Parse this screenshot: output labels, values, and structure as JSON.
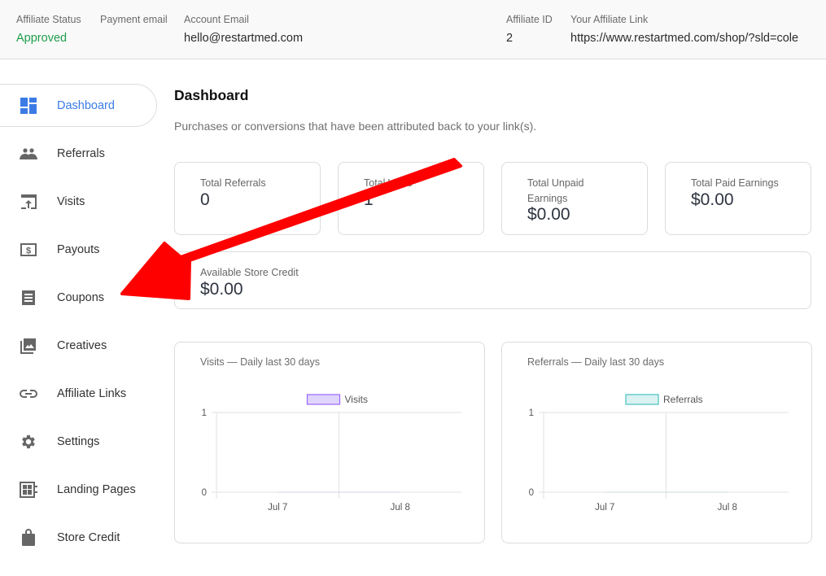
{
  "header": {
    "fields": [
      {
        "label": "Affiliate Status",
        "value": "Approved",
        "status_color": "#1f9d4b"
      },
      {
        "label": "Payment email",
        "value": ""
      },
      {
        "label": "Account Email",
        "value": "hello@restartmed.com"
      },
      {
        "label": "Affiliate ID",
        "value": "2"
      },
      {
        "label": "Your Affiliate Link",
        "value": "https://www.restartmed.com/shop/?sld=cole"
      }
    ]
  },
  "sidebar": {
    "accent_color": "#3b7be6",
    "items": [
      {
        "label": "Dashboard",
        "icon": "dashboard-icon",
        "active": true
      },
      {
        "label": "Referrals",
        "icon": "people-icon"
      },
      {
        "label": "Visits",
        "icon": "open-in-browser-icon"
      },
      {
        "label": "Payouts",
        "icon": "dollar-icon"
      },
      {
        "label": "Coupons",
        "icon": "receipt-icon"
      },
      {
        "label": "Creatives",
        "icon": "image-library-icon"
      },
      {
        "label": "Affiliate Links",
        "icon": "link-icon"
      },
      {
        "label": "Settings",
        "icon": "gear-icon"
      },
      {
        "label": "Landing Pages",
        "icon": "page-layout-icon"
      },
      {
        "label": "Store Credit",
        "icon": "shopping-bag-icon"
      }
    ]
  },
  "main": {
    "title": "Dashboard",
    "description": "Purchases or conversions that have been attributed back to your link(s).",
    "stats": [
      {
        "label": "Total Referrals",
        "value": "0"
      },
      {
        "label": "Total Visits",
        "value": "1"
      },
      {
        "label": "Total Unpaid Earnings",
        "value": "$0.00"
      },
      {
        "label": "Total Paid Earnings",
        "value": "$0.00"
      },
      {
        "label": "Available Store Credit",
        "value": "$0.00"
      }
    ]
  },
  "annotation": {
    "type": "arrow",
    "color": "#ff0000",
    "points_to": "Coupons"
  },
  "chart_data": [
    {
      "type": "line",
      "title": "Visits — Daily last 30 days",
      "categories": [
        "Jul 7",
        "Jul 8"
      ],
      "series": [
        {
          "name": "Visits",
          "values": [
            0,
            0
          ],
          "color": "#9966ff",
          "fill": "#e0d5ff"
        }
      ],
      "yticks": [
        "0",
        "1"
      ],
      "ylim": [
        0,
        1
      ],
      "legend": "top-center",
      "grid": true
    },
    {
      "type": "line",
      "title": "Referrals — Daily last 30 days",
      "categories": [
        "Jul 7",
        "Jul 8"
      ],
      "series": [
        {
          "name": "Referrals",
          "values": [
            0,
            0
          ],
          "color": "#4bc0c0",
          "fill": "#dbf2f2"
        }
      ],
      "yticks": [
        "0",
        "1"
      ],
      "ylim": [
        0,
        1
      ],
      "legend": "top-center",
      "grid": true
    }
  ]
}
